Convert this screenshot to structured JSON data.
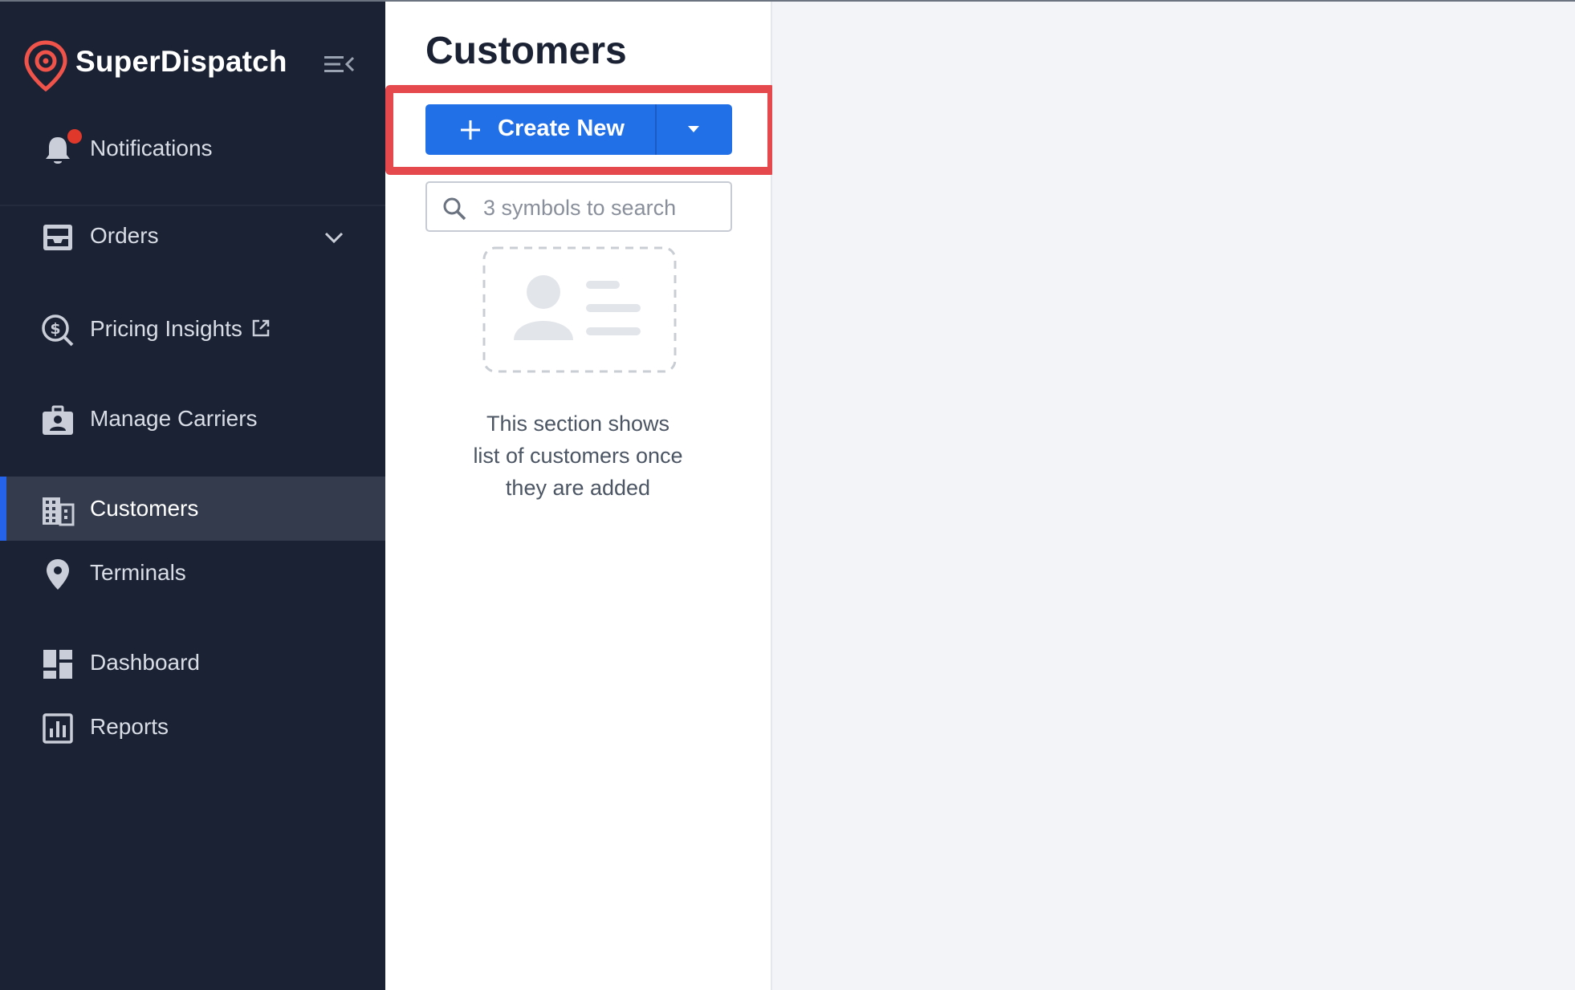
{
  "app": {
    "brand_name": "SuperDispatch",
    "accent_color": "#2270e8",
    "sidebar_color": "#1b2233",
    "highlight_color": "#e5484d"
  },
  "sidebar": {
    "items": [
      {
        "label": "Notifications",
        "icon": "bell-icon"
      },
      {
        "label": "Orders",
        "icon": "inbox-icon"
      },
      {
        "label": "Pricing Insights",
        "icon": "pricing-search-icon"
      },
      {
        "label": "Manage Carriers",
        "icon": "briefcase-user-icon"
      },
      {
        "label": "Customers",
        "icon": "building-icon",
        "active": true
      },
      {
        "label": "Terminals",
        "icon": "location-pin-icon"
      },
      {
        "label": "Dashboard",
        "icon": "dashboard-icon"
      },
      {
        "label": "Reports",
        "icon": "bar-chart-icon"
      }
    ]
  },
  "main": {
    "title": "Customers",
    "create_button_label": "Create New",
    "search_placeholder": "3 symbols to search",
    "empty_state_lines": [
      "This section shows",
      "list of customers once",
      "they are added"
    ]
  }
}
